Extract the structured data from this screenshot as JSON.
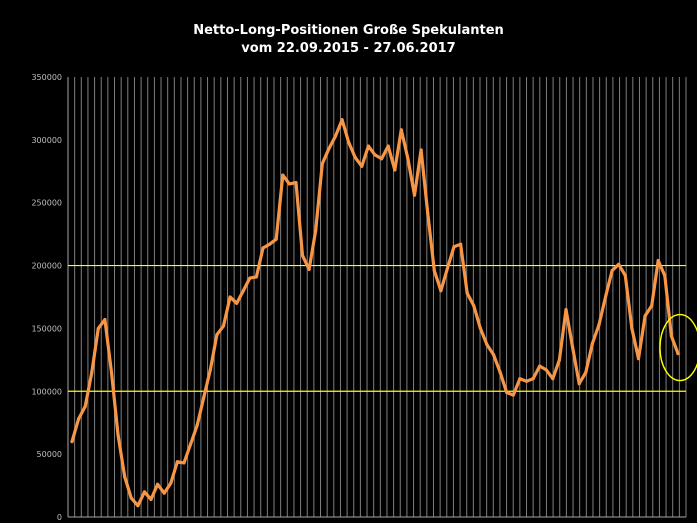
{
  "chart_data": {
    "type": "line",
    "title": "Netto-Long-Positionen  Große Spekulanten",
    "subtitle": "vom 22.09.2015  - 27.06.2017",
    "ylim": [
      0,
      350000
    ],
    "yticks": [
      "350000",
      "300000",
      "250000",
      "200000",
      "150000",
      "100000",
      "50000",
      "0"
    ],
    "grid": "vertical",
    "reference_lines": [
      200000,
      100000
    ],
    "colors": {
      "line": "#F79646",
      "reference": "#FFFF00",
      "grid": "#7f7f7f",
      "background": "#000000",
      "highlight": "#FFFF00"
    },
    "series": [
      {
        "values": [
          60000,
          78000,
          88000,
          115000,
          150000,
          157000,
          115000,
          65000,
          32000,
          15000,
          9000,
          20000,
          14000,
          26000,
          19000,
          27000,
          44000,
          43000,
          58000,
          73000,
          95000,
          117000,
          145000,
          152000,
          175000,
          170000,
          180000,
          190000,
          191000,
          214000,
          217000,
          221000,
          272000,
          265000,
          266000,
          208000,
          197000,
          228000,
          281000,
          293000,
          303000,
          316000,
          298000,
          286000,
          279000,
          295000,
          288000,
          285000,
          295000,
          276000,
          308000,
          285000,
          256000,
          292000,
          242000,
          196000,
          180000,
          198000,
          215000,
          217000,
          178000,
          168000,
          150000,
          137000,
          129000,
          115000,
          99000,
          97000,
          110000,
          108000,
          110000,
          120000,
          117000,
          110000,
          125000,
          165000,
          135000,
          106000,
          115000,
          138000,
          153000,
          175000,
          196000,
          201000,
          192000,
          150000,
          126000,
          160000,
          168000,
          204000,
          192000,
          144000,
          130000
        ]
      }
    ],
    "highlight_last_point": true
  }
}
